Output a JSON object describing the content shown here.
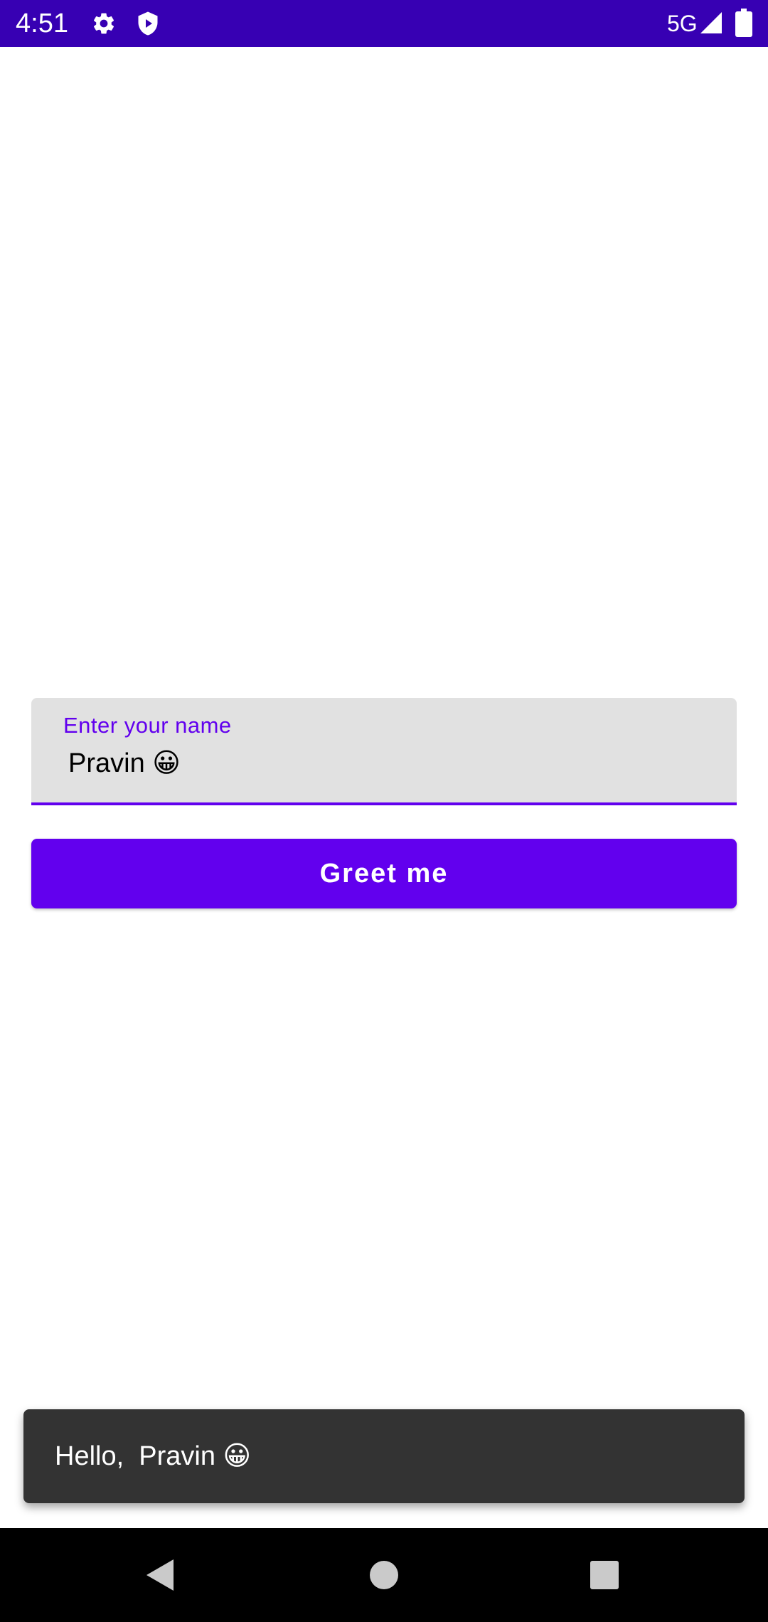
{
  "status_bar": {
    "time": "4:51",
    "network": "5G",
    "icons": [
      "gear-icon",
      "shield-play-icon",
      "signal-icon",
      "battery-icon"
    ],
    "background_color": "#3700b3"
  },
  "form": {
    "name_field": {
      "label": "Enter your name",
      "value": "Pravin 😀"
    },
    "greet_button_label": "Greet me",
    "accent_color": "#6200ee"
  },
  "snackbar": {
    "message": "Hello,  Pravin 😀"
  },
  "nav_bar": {
    "icons": [
      "back-icon",
      "home-icon",
      "recents-icon"
    ]
  }
}
